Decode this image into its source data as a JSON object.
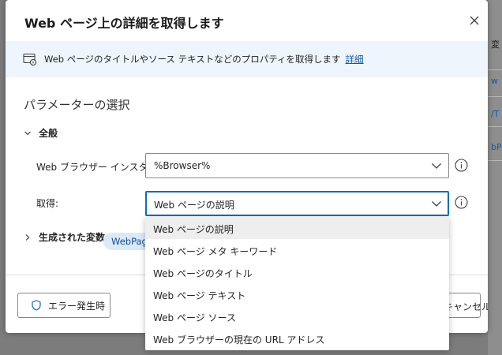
{
  "dialog": {
    "title": "Web ページ上の詳細を取得します",
    "close_icon": "close-icon"
  },
  "info": {
    "text": "Web ページのタイトルやソース テキストなどのプロパティを取得します",
    "link": "詳細"
  },
  "parameters": {
    "section_title": "パラメーターの選択",
    "general_label": "全般",
    "browser_label": "Web ブラウザー インスタンス:",
    "browser_value": "%Browser%",
    "get_label": "取得:",
    "get_value": "Web ページの説明"
  },
  "generated": {
    "label": "生成された変数",
    "variable": "WebPageProperty"
  },
  "footer": {
    "error_label": "エラー発生時",
    "cancel_label": "キャンセル"
  },
  "dropdown": {
    "options": [
      "Web ページの説明",
      "Web ページ メタ キーワード",
      "Web ページのタイトル",
      "Web ページ テキスト",
      "Web ページ ソース",
      "Web ブラウザーの現在の URL アドレス"
    ],
    "selected_index": 0
  },
  "background": {
    "fragments": [
      "変",
      "w",
      "/T",
      "bP"
    ]
  },
  "colors": {
    "accent": "#0f6cbd",
    "link": "#0f5aa8",
    "info_bar": "#eef5fc",
    "pill": "#dce9f7"
  }
}
